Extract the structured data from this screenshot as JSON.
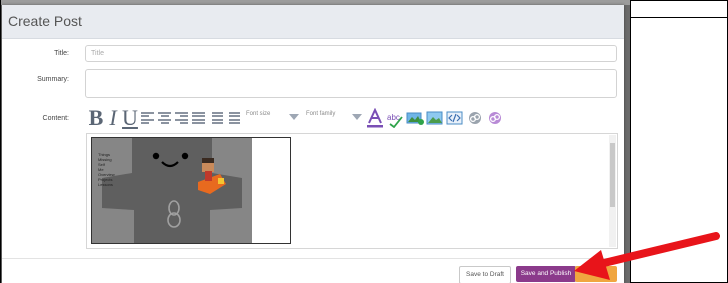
{
  "modal": {
    "title": "Create Post"
  },
  "form": {
    "title_label": "Title:",
    "title_placeholder": "Title",
    "summary_label": "Summary:",
    "summary_value": "",
    "content_label": "Content:"
  },
  "toolbar": {
    "bold": "B",
    "italic": "I",
    "underline": "U",
    "font_size_placeholder": "Font size",
    "font_family_placeholder": "Font family",
    "icons": [
      "align-left-icon",
      "align-center-icon",
      "align-right-icon",
      "align-justify-icon",
      "unordered-list-icon",
      "ordered-list-icon",
      "text-color-icon",
      "spell-check-icon",
      "insert-image-icon",
      "insert-picture-icon",
      "source-code-icon",
      "insert-link-icon",
      "remove-link-icon"
    ]
  },
  "editor": {
    "image_text_lines": [
      "Things",
      "Missing",
      "Self",
      "Me",
      "Overview",
      "Projects",
      "Lessons"
    ]
  },
  "footer": {
    "save_draft_label": "Save to Draft",
    "save_publish_label": "Save and Publish",
    "extra_label": ""
  },
  "colors": {
    "publish_button": "#8b3a8b",
    "arrow": "#e8141a",
    "header_bg": "#e8ebf0"
  }
}
